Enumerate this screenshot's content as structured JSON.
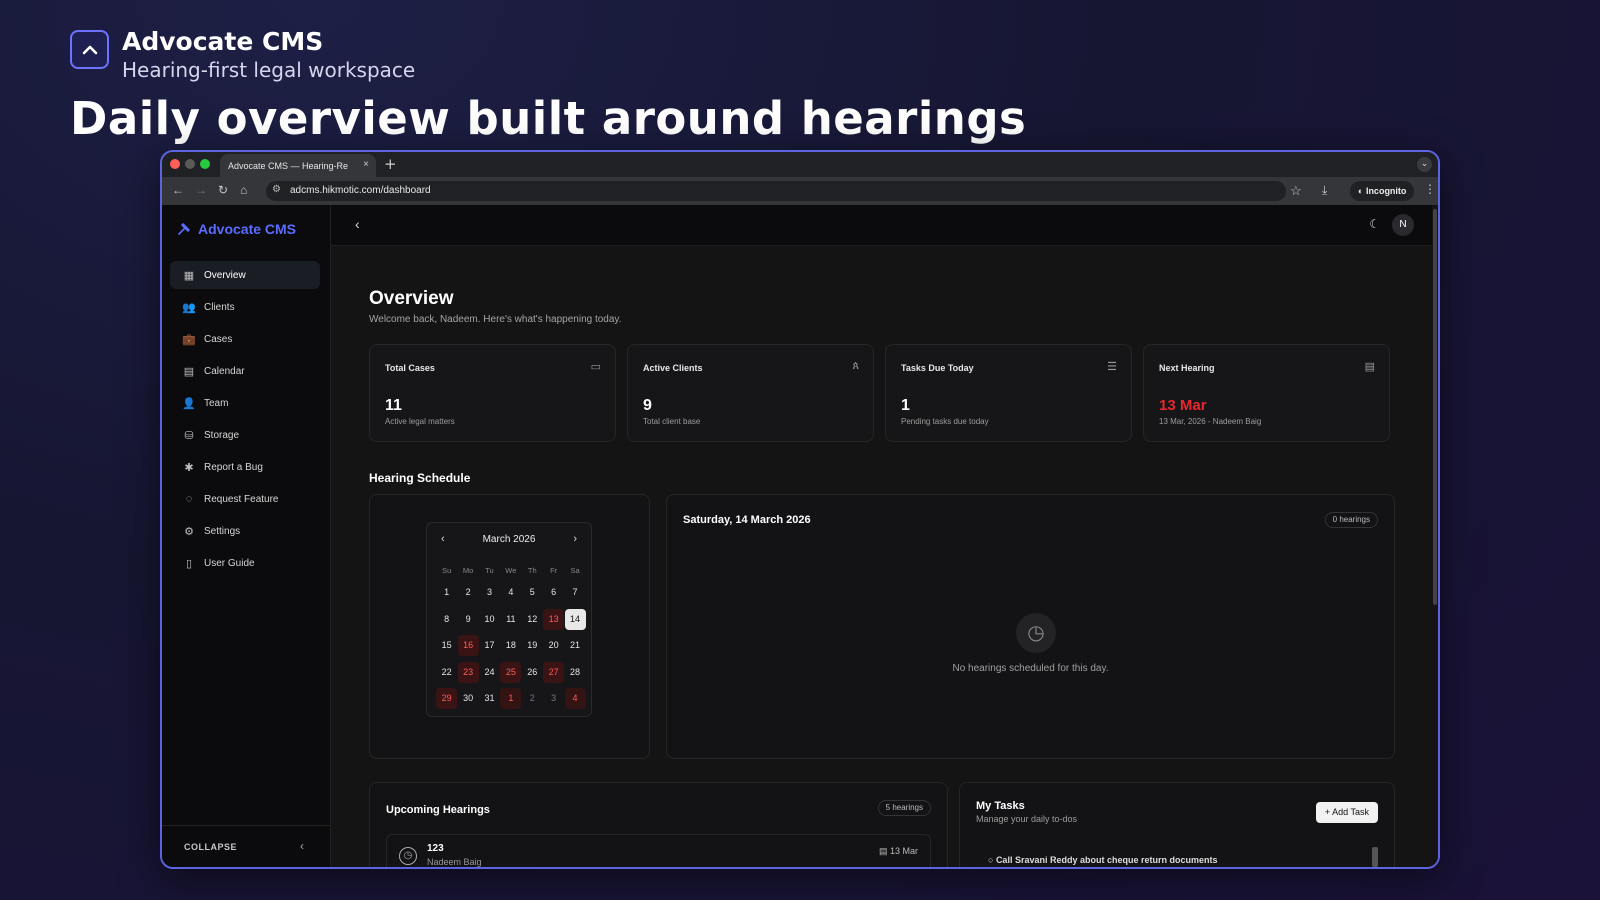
{
  "hero": {
    "title": "Advocate CMS",
    "subtitle": "Hearing-first legal workspace",
    "headline": "Daily overview built around hearings"
  },
  "browser": {
    "tab_title": "Advocate CMS — Hearing-Re",
    "url": "adcms.hikmotic.com/dashboard",
    "incognito_label": "Incognito",
    "new_tab": "+",
    "close_tab": "×"
  },
  "sidebar": {
    "brand": "Advocate CMS",
    "items": [
      {
        "label": "Overview",
        "icon": "grid-icon",
        "glyph": "▦"
      },
      {
        "label": "Clients",
        "icon": "users-icon",
        "glyph": "👥"
      },
      {
        "label": "Cases",
        "icon": "briefcase-icon",
        "glyph": "💼"
      },
      {
        "label": "Calendar",
        "icon": "calendar-icon",
        "glyph": "▤"
      },
      {
        "label": "Team",
        "icon": "team-icon",
        "glyph": "👤"
      },
      {
        "label": "Storage",
        "icon": "storage-icon",
        "glyph": "⛁"
      },
      {
        "label": "Report a Bug",
        "icon": "bug-icon",
        "glyph": "✱"
      },
      {
        "label": "Request Feature",
        "icon": "lightbulb-icon",
        "glyph": "◌"
      },
      {
        "label": "Settings",
        "icon": "gear-icon",
        "glyph": "⚙"
      },
      {
        "label": "User Guide",
        "icon": "book-icon",
        "glyph": "▯"
      }
    ],
    "collapse_label": "COLLAPSE"
  },
  "topbar": {
    "avatar_initial": "N"
  },
  "overview": {
    "title": "Overview",
    "subtitle": "Welcome back, Nadeem. Here's what's happening today."
  },
  "stats": [
    {
      "label": "Total Cases",
      "value": "11",
      "sub": "Active legal matters",
      "icon": "briefcase-icon"
    },
    {
      "label": "Active Clients",
      "value": "9",
      "sub": "Total client base",
      "icon": "users-icon"
    },
    {
      "label": "Tasks Due Today",
      "value": "1",
      "sub": "Pending tasks due today",
      "icon": "checklist-icon"
    },
    {
      "label": "Next Hearing",
      "value": "13 Mar",
      "sub": "13 Mar, 2026 - Nadeem Baig",
      "icon": "calendar-icon"
    }
  ],
  "hearing_schedule": {
    "title": "Hearing Schedule",
    "calendar": {
      "month_label": "March 2026",
      "weekdays": [
        "Su",
        "Mo",
        "Tu",
        "We",
        "Th",
        "Fr",
        "Sa"
      ],
      "days": [
        {
          "d": "1"
        },
        {
          "d": "2"
        },
        {
          "d": "3"
        },
        {
          "d": "4"
        },
        {
          "d": "5"
        },
        {
          "d": "6"
        },
        {
          "d": "7"
        },
        {
          "d": "8"
        },
        {
          "d": "9"
        },
        {
          "d": "10"
        },
        {
          "d": "11"
        },
        {
          "d": "12"
        },
        {
          "d": "13",
          "hearing": true
        },
        {
          "d": "14",
          "selected": true
        },
        {
          "d": "15"
        },
        {
          "d": "16",
          "hearing": true
        },
        {
          "d": "17"
        },
        {
          "d": "18"
        },
        {
          "d": "19"
        },
        {
          "d": "20"
        },
        {
          "d": "21"
        },
        {
          "d": "22"
        },
        {
          "d": "23",
          "hearing": true
        },
        {
          "d": "24"
        },
        {
          "d": "25",
          "hearing": true
        },
        {
          "d": "26"
        },
        {
          "d": "27",
          "hearing": true
        },
        {
          "d": "28"
        },
        {
          "d": "29",
          "hearing": true
        },
        {
          "d": "30"
        },
        {
          "d": "31"
        },
        {
          "d": "1",
          "hearing": true,
          "outside": true
        },
        {
          "d": "2",
          "outside": true
        },
        {
          "d": "3",
          "outside": true
        },
        {
          "d": "4",
          "hearing": true,
          "outside": true
        }
      ]
    },
    "day_title": "Saturday, 14 March 2026",
    "day_count": "0 hearings",
    "empty_text": "No hearings scheduled for this day."
  },
  "upcoming": {
    "title": "Upcoming Hearings",
    "count": "5 hearings",
    "rows": [
      {
        "name": "123",
        "sub": "Nadeem Baig",
        "date": "13 Mar"
      }
    ]
  },
  "tasks": {
    "title": "My Tasks",
    "subtitle": "Manage your daily to-dos",
    "add_label": "Add Task",
    "first_task": "Call Sravani Reddy about cheque return documents"
  },
  "colors": {
    "accent": "#5b6cff",
    "hearing_red": "#e5282f",
    "frame_border": "#5e63e0"
  }
}
